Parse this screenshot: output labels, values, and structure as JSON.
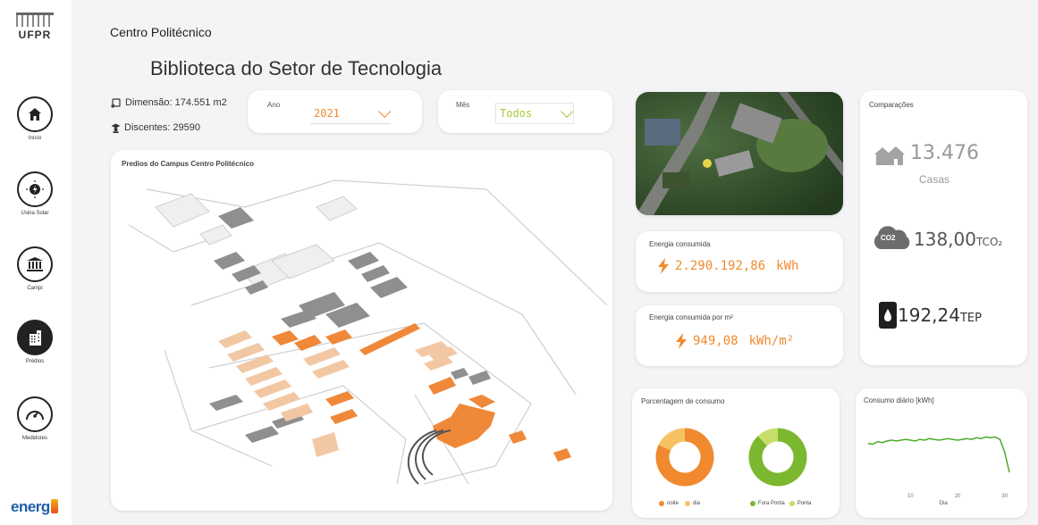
{
  "brand": {
    "logo_text": "UFPR",
    "footer_logo": "energ"
  },
  "sidebar": {
    "items": [
      {
        "label": "Início",
        "icon": "home-icon",
        "active": false
      },
      {
        "label": "Usina Solar",
        "icon": "solar-icon",
        "active": false
      },
      {
        "label": "Campi",
        "icon": "campus-icon",
        "active": false
      },
      {
        "label": "Prédios",
        "icon": "building-icon",
        "active": true
      },
      {
        "label": "Medidores",
        "icon": "gauge-icon",
        "active": false
      }
    ]
  },
  "header": {
    "campus": "Centro Politécnico",
    "title": "Biblioteca do Setor de Tecnologia",
    "dimension": "Dimensão: 174.551 m2",
    "students": "Discentes: 29590"
  },
  "filters": {
    "year_label": "Ano",
    "year_value": "2021",
    "month_label": "Mês",
    "month_value": "Todos"
  },
  "map": {
    "title": "Predios do Campus Centro Politécnico"
  },
  "energy": {
    "consumed_label": "Energia consumida",
    "consumed_value": "2.290.192,86",
    "consumed_unit": "kWh",
    "per_m2_label": "Energia consumida por m²",
    "per_m2_value": "949,08",
    "per_m2_unit": "kWh/m²"
  },
  "comparisons": {
    "title": "Comparações",
    "houses_value": "13.476",
    "houses_label": "Casas",
    "co2_badge": "CO2",
    "co2_value": "138,00",
    "co2_unit": "TCO₂",
    "oil_value": "192,24",
    "oil_unit": "TEP"
  },
  "consumption_pct": {
    "title": "Porcentagem de consumo",
    "legend1": [
      "noite",
      "dia"
    ],
    "legend2": [
      "Fora Ponta",
      "Ponta"
    ]
  },
  "daily": {
    "title": "Consumo diário [kWh]",
    "xlabel": "Dia",
    "ticks": [
      "10",
      "20",
      "30"
    ]
  },
  "colors": {
    "orange": "#f18a2f",
    "light_orange": "#f6c263",
    "green": "#7cb82f",
    "light_green": "#c9dd6a",
    "line_green": "#4caa2b",
    "gray_icon": "#a3a3a3",
    "dark": "#222222"
  },
  "chart_data": [
    {
      "type": "pie",
      "labels": [
        "noite",
        "dia"
      ],
      "values": [
        82,
        18
      ],
      "colors": [
        "#f18a2f",
        "#f6c263"
      ],
      "donut": true
    },
    {
      "type": "pie",
      "labels": [
        "Fora Ponta",
        "Ponta"
      ],
      "values": [
        88,
        12
      ],
      "colors": [
        "#7cb82f",
        "#c9dd6a"
      ],
      "donut": true
    },
    {
      "type": "line",
      "title": "Consumo diário [kWh]",
      "xlabel": "Dia",
      "x": [
        1,
        2,
        3,
        4,
        5,
        6,
        7,
        8,
        9,
        10,
        11,
        12,
        13,
        14,
        15,
        16,
        17,
        18,
        19,
        20,
        21,
        22,
        23,
        24,
        25,
        26,
        27,
        28,
        29,
        30,
        31
      ],
      "y": [
        5600,
        5500,
        5800,
        5700,
        5900,
        6000,
        5900,
        6000,
        6100,
        6000,
        5900,
        6100,
        6000,
        6200,
        6100,
        6000,
        6100,
        6200,
        6100,
        6000,
        6100,
        6200,
        6100,
        6300,
        6200,
        6400,
        6300,
        6400,
        6100,
        4500,
        2000
      ],
      "xticks": [
        10,
        20,
        30
      ],
      "color": "#4caa2b"
    }
  ]
}
